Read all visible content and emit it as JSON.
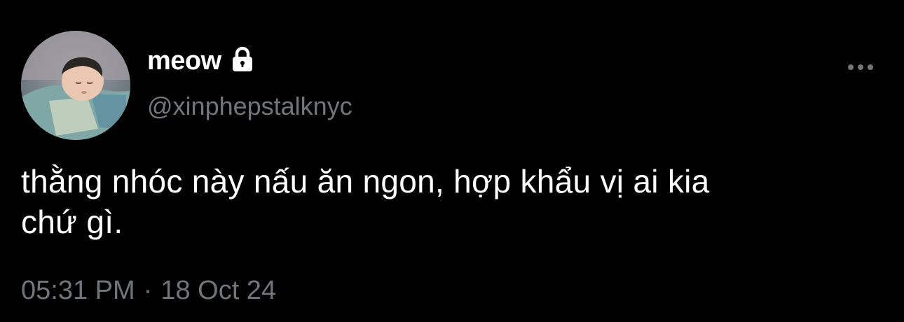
{
  "user": {
    "display_name": "meow",
    "handle": "@xinphepstalknyc",
    "protected_icon": "lock-icon",
    "avatar_alt": "sleeping baby photo"
  },
  "tweet": {
    "text_line1": "thằng nhóc này nấu ăn ngon, hợp khẩu vị ai kia",
    "text_line2": "chứ gì.",
    "time": "05:31 PM",
    "separator": "·",
    "date": "18 Oct 24"
  },
  "actions": {
    "more_icon": "more-horizontal-icon"
  },
  "colors": {
    "background": "#000000",
    "primary_text": "#ffffff",
    "secondary_text": "#71767b"
  }
}
